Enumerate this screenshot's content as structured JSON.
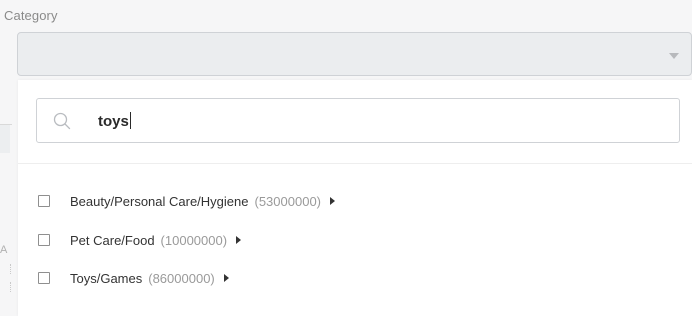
{
  "field": {
    "label": "Category",
    "selected_value": ""
  },
  "search": {
    "value": "toys",
    "placeholder": ""
  },
  "options": [
    {
      "label": "Beauty/Personal Care/Hygiene",
      "count": "(53000000)"
    },
    {
      "label": "Pet Care/Food",
      "count": "(10000000)"
    },
    {
      "label": "Toys/Games",
      "count": "(86000000)"
    }
  ],
  "background": {
    "edge_char": "A"
  }
}
